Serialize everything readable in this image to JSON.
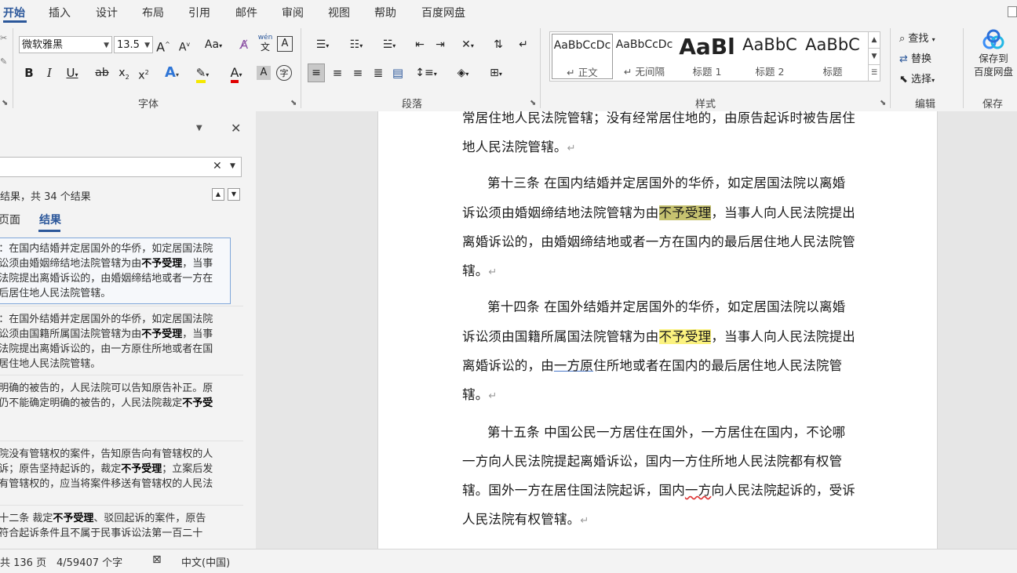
{
  "tabs": [
    "开始",
    "插入",
    "设计",
    "布局",
    "引用",
    "邮件",
    "审阅",
    "视图",
    "帮助",
    "百度网盘"
  ],
  "font": {
    "name": "微软雅黑",
    "size": "13.5",
    "group_label": "字体"
  },
  "paragraph": {
    "group_label": "段落"
  },
  "styles": {
    "group_label": "样式",
    "items": [
      {
        "sample": "AaBbCcDc",
        "name": "↵ 正文"
      },
      {
        "sample": "AaBbCcDc",
        "name": "↵ 无间隔"
      },
      {
        "sample": "AaBl",
        "name": "标题 1"
      },
      {
        "sample": "AaBbC",
        "name": "标题 2"
      },
      {
        "sample": "AaBbC",
        "name": "标题"
      }
    ]
  },
  "editing": {
    "find": "查找",
    "replace": "替换",
    "select": "选择",
    "group_label": "编辑"
  },
  "save": {
    "line1": "保存到",
    "line2": "百度网盘",
    "group_label": "保存"
  },
  "nav": {
    "result_count": "结果，共 34 个结果",
    "tab_pages": "页面",
    "tab_results": "结果",
    "results": [
      {
        "lines": [
          [
            "：在国内结婚并定居国外的华侨，如定居国法院",
            ""
          ],
          [
            "讼须由婚姻缔结地法院管辖为由",
            "不予受理",
            "，当事"
          ],
          [
            "法院提出离婚诉讼的，由婚姻缔结地或者一方在",
            ""
          ],
          [
            "后居住地人民法院管辖。",
            ""
          ]
        ]
      },
      {
        "lines": [
          [
            "：在国外结婚并定居国外的华侨，如定居国法院",
            ""
          ],
          [
            "讼须由国籍所属国法院管辖为由",
            "不予受理",
            "，当事"
          ],
          [
            "法院提出离婚诉讼的，由一方原住所地或者在国",
            ""
          ],
          [
            "居住地人民法院管辖。",
            ""
          ]
        ]
      },
      {
        "lines": [
          [
            "明确的被告的，人民法院可以告知原告补正。原",
            ""
          ],
          [
            "仍不能确定明确的被告的，人民法院裁定",
            "不予受",
            ""
          ]
        ]
      },
      {
        "lines": [
          [
            "院没有管辖权的案件，告知原告向有管辖权的人",
            ""
          ],
          [
            "诉；原告坚持起诉的，裁定",
            "不予受理",
            "；立案后发"
          ],
          [
            "有管辖权的，应当将案件移送有管辖权的人民法",
            ""
          ]
        ]
      },
      {
        "lines": [
          [
            "十二条  裁定",
            "不予受理",
            "、驳回起诉的案件，原告"
          ],
          [
            "符合起诉条件且不属于民事诉讼法第一百二十",
            ""
          ]
        ]
      }
    ]
  },
  "doc": {
    "l0": "常居住地人民法院管辖；没有经常居住地的，由原告起诉时被告居住",
    "l1": "地人民法院管辖。",
    "p13a": "第十三条   在国内结婚并定居国外的华侨，如定居国法院以离婚",
    "p13b1": "诉讼须由婚姻缔结地法院管辖为由",
    "hit": "不予受理",
    "p13b2": "，当事人向人民法院提出",
    "p13c": "离婚诉讼的，由婚姻缔结地或者一方在国内的最后居住地人民法院管",
    "p13d": "辖。",
    "p14a": "第十四条   在国外结婚并定居国外的华侨，如定居国法院以离婚",
    "p14b1": "诉讼须由国籍所属国法院管辖为由",
    "p14b2": "，当事人向人民法院提出",
    "p14c1": "离婚诉讼的，由",
    "p14c2": "一方原",
    "p14c3": "住所地或者在国内的最后居住地人民法院管",
    "p14d": "辖。",
    "p15a": "第十五条   中国公民一方居住在国外，一方居住在国内，不论哪",
    "p15b": "一方向人民法院提起离婚诉讼，国内一方住所地人民法院都有权管",
    "p15c1": "辖。国外一方在居住国法院起诉，国内",
    "p15c2": "一方",
    "p15c3": "向人民法院起诉的，受诉",
    "p15d": "人民法院有权管辖。",
    "mark": "↵"
  },
  "status": {
    "pages": "共 136 页",
    "words": "4/59407 个字",
    "lang": "中文(中国)"
  },
  "colors": {
    "accent": "#2b579a",
    "highlight": "#fbf27f",
    "current_highlight": "#c6c270"
  }
}
